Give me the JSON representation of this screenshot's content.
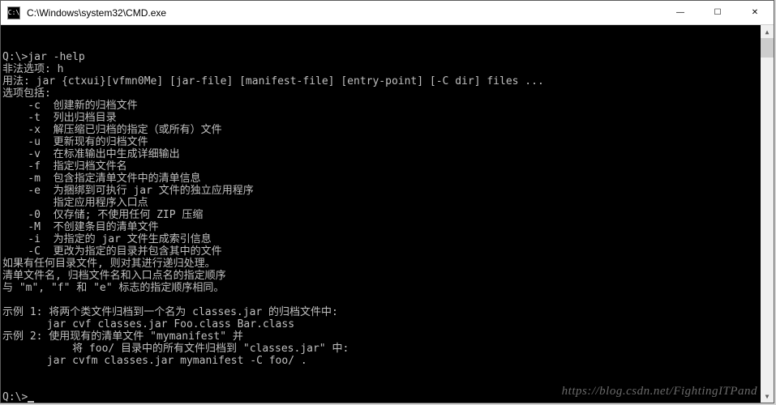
{
  "window": {
    "title": "C:\\Windows\\system32\\CMD.exe",
    "icon_label": "C:\\"
  },
  "controls": {
    "minimize": "—",
    "maximize": "☐",
    "close": "✕"
  },
  "console": {
    "lines": [
      "Q:\\>jar -help",
      "非法选项: h",
      "用法: jar {ctxui}[vfmn0Me] [jar-file] [manifest-file] [entry-point] [-C dir] files ...",
      "选项包括:",
      "    -c  创建新的归档文件",
      "    -t  列出归档目录",
      "    -x  解压缩已归档的指定（或所有）文件",
      "    -u  更新现有的归档文件",
      "    -v  在标准输出中生成详细输出",
      "    -f  指定归档文件名",
      "    -m  包含指定清单文件中的清单信息",
      "    -e  为捆绑到可执行 jar 文件的独立应用程序",
      "        指定应用程序入口点",
      "    -0  仅存储; 不使用任何 ZIP 压缩",
      "    -M  不创建条目的清单文件",
      "    -i  为指定的 jar 文件生成索引信息",
      "    -C  更改为指定的目录并包含其中的文件",
      "如果有任何目录文件, 则对其进行递归处理。",
      "清单文件名, 归档文件名和入口点名的指定顺序",
      "与 \"m\", \"f\" 和 \"e\" 标志的指定顺序相同。",
      "",
      "示例 1: 将两个类文件归档到一个名为 classes.jar 的归档文件中:",
      "       jar cvf classes.jar Foo.class Bar.class",
      "示例 2: 使用现有的清单文件 \"mymanifest\" 并",
      "           将 foo/ 目录中的所有文件归档到 \"classes.jar\" 中:",
      "       jar cvfm classes.jar mymanifest -C foo/ .",
      "",
      "",
      "Q:\\>"
    ]
  },
  "watermark": "https://blog.csdn.net/FightingITPand"
}
